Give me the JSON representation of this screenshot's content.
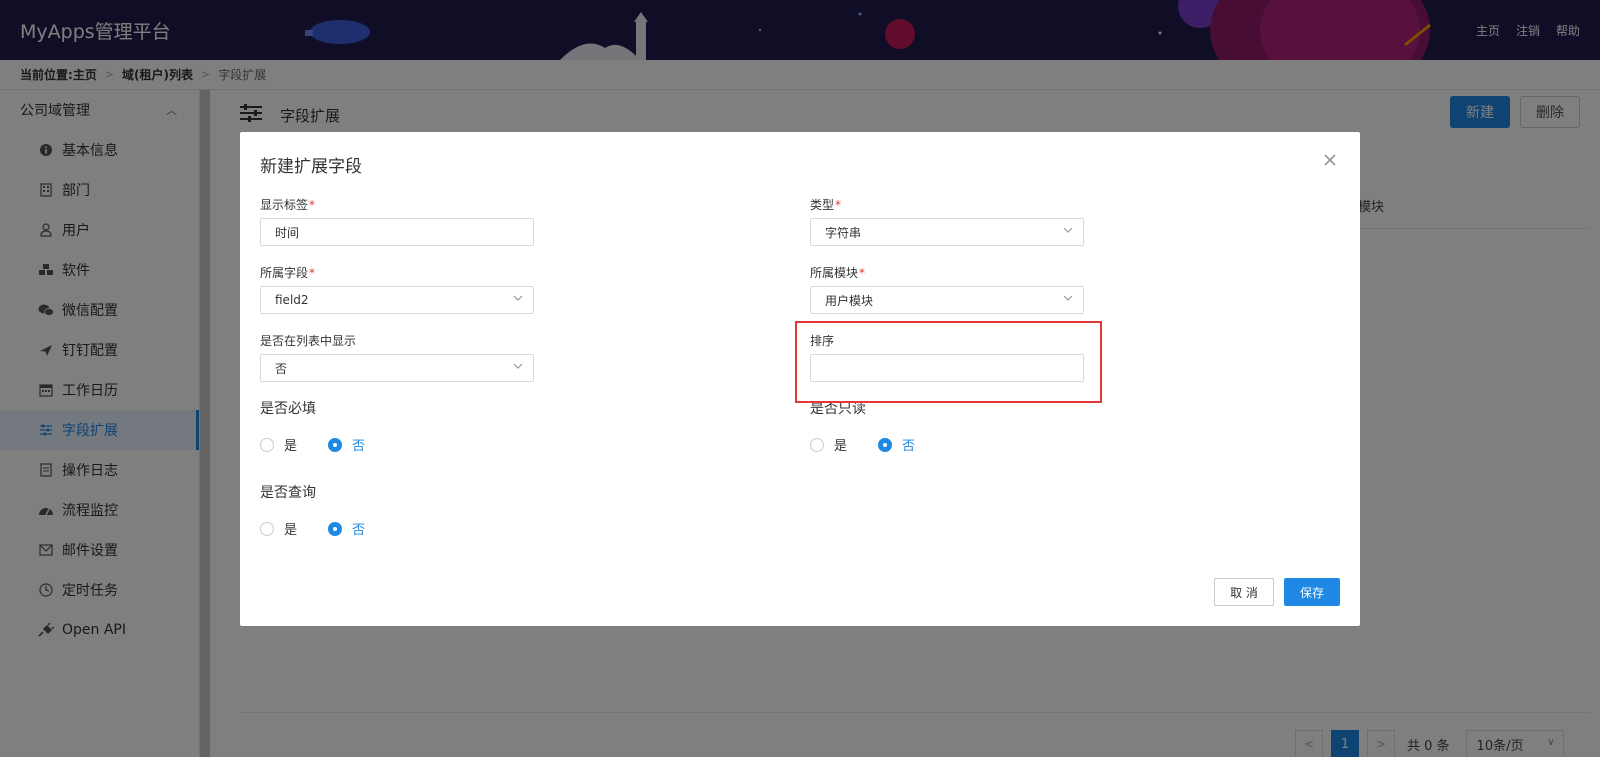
{
  "header": {
    "brand": "MyApps管理平台",
    "links": {
      "home": "主页",
      "logout": "注销",
      "help": "帮助"
    }
  },
  "breadcrumb": {
    "prefix": "当前位置:",
    "home": "主页",
    "list": "域(租户)列表",
    "current": "字段扩展"
  },
  "sidebar": {
    "group": "公司域管理",
    "items": [
      {
        "label": "基本信息",
        "icon": "info-icon"
      },
      {
        "label": "部门",
        "icon": "building-icon"
      },
      {
        "label": "用户",
        "icon": "user-icon"
      },
      {
        "label": "软件",
        "icon": "cubes-icon"
      },
      {
        "label": "微信配置",
        "icon": "wechat-icon"
      },
      {
        "label": "钉钉配置",
        "icon": "plane-icon"
      },
      {
        "label": "工作日历",
        "icon": "calendar-icon"
      },
      {
        "label": "字段扩展",
        "icon": "sliders-icon",
        "active": true
      },
      {
        "label": "操作日志",
        "icon": "log-icon"
      },
      {
        "label": "流程监控",
        "icon": "dashboard-icon"
      },
      {
        "label": "邮件设置",
        "icon": "mail-icon"
      },
      {
        "label": "定时任务",
        "icon": "clock-icon"
      },
      {
        "label": "Open API",
        "icon": "plug-icon"
      }
    ]
  },
  "main": {
    "title": "字段扩展",
    "new_label": "新建",
    "delete_label": "删除",
    "column_peek": "模块",
    "pager": {
      "page": "1",
      "total": "共 0 条",
      "page_size": "10条/页"
    }
  },
  "modal": {
    "title": "新建扩展字段",
    "fields": {
      "display_label": {
        "label": "显示标签",
        "value": "时间"
      },
      "type": {
        "label": "类型",
        "value": "字符串"
      },
      "field": {
        "label": "所属字段",
        "value": "field2"
      },
      "module": {
        "label": "所属模块",
        "value": "用户模块"
      },
      "show_in_list": {
        "label": "是否在列表中显示",
        "value": "否"
      },
      "sort": {
        "label": "排序",
        "value": ""
      }
    },
    "required": {
      "label": "是否必填",
      "yes": "是",
      "no": "否",
      "selected": "否"
    },
    "readonly": {
      "label": "是否只读",
      "yes": "是",
      "no": "否",
      "selected": "否"
    },
    "query": {
      "label": "是否查询",
      "yes": "是",
      "no": "否",
      "selected": "否"
    },
    "cancel_label": "取 消",
    "save_label": "保存"
  },
  "colors": {
    "accent": "#1e88e5",
    "header": "#1f1d4d",
    "highlight": "#e53935"
  }
}
